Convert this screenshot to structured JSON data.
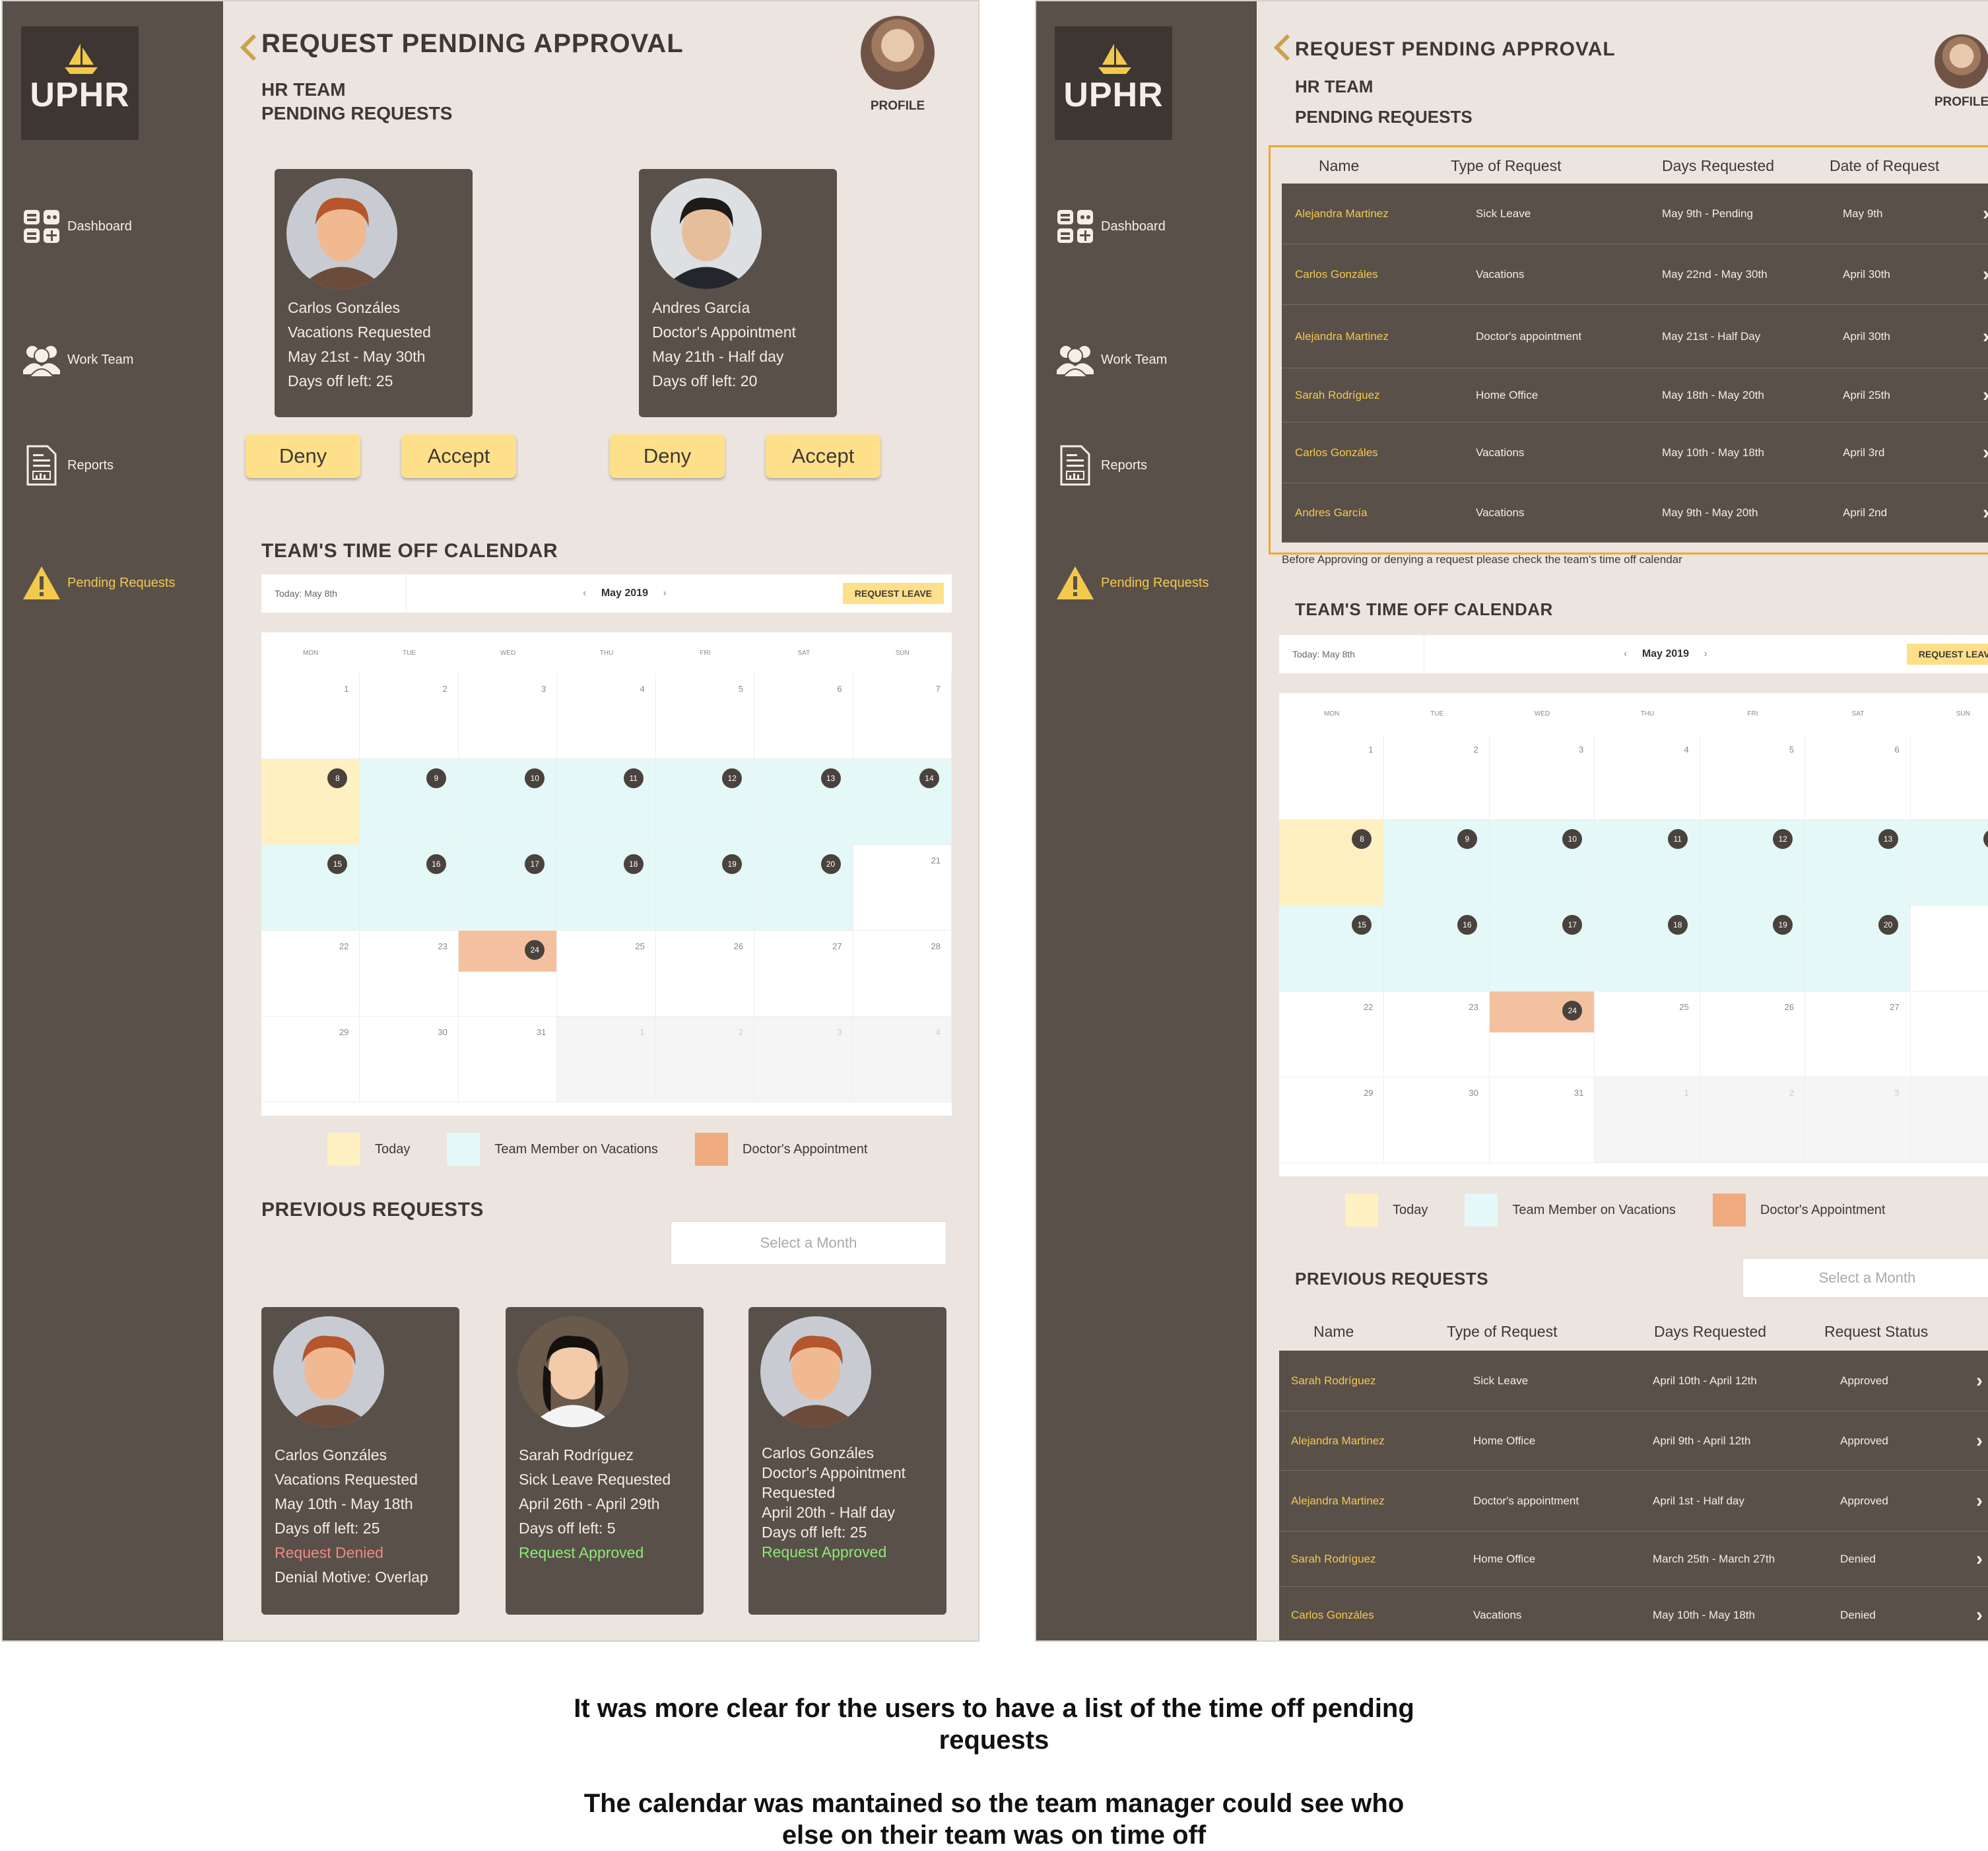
{
  "sidebar": {
    "logo": "UPHR",
    "items": [
      "Dashboard",
      "Work Team",
      "Reports",
      "Pending Requests"
    ]
  },
  "header": {
    "title": "REQUEST PENDING APPROVAL",
    "team": "HR TEAM",
    "subtitle": "PENDING REQUESTS",
    "profile": "PROFILE"
  },
  "pending_cards": [
    {
      "name": "Carlos Gonzáles",
      "type": "Vacations Requested",
      "dates": "May 21st - May 30th",
      "left": "Days off left: 25"
    },
    {
      "name": "Andres García",
      "type": "Doctor's Appointment",
      "dates": "May 21th - Half day",
      "left": "Days off left: 20"
    }
  ],
  "buttons": {
    "deny": "Deny",
    "accept": "Accept"
  },
  "calendar": {
    "section": "TEAM'S TIME OFF CALENDAR",
    "today": "Today: May 8th",
    "month": "May 2019",
    "request": "REQUEST LEAVE",
    "days": [
      "MON",
      "TUE",
      "WED",
      "THU",
      "FRI",
      "SAT",
      "SUN"
    ],
    "grid": [
      [
        "1",
        "2",
        "3",
        "4",
        "5",
        "6",
        "7"
      ],
      [
        "8",
        "9",
        "10",
        "11",
        "12",
        "13",
        "14"
      ],
      [
        "15",
        "16",
        "17",
        "18",
        "19",
        "20",
        "21"
      ],
      [
        "22",
        "23",
        "24",
        "25",
        "26",
        "27",
        "28"
      ],
      [
        "29",
        "30",
        "31",
        "1",
        "2",
        "3",
        "4"
      ]
    ],
    "legend": [
      "Today",
      "Team Member on Vacations",
      "Doctor's Appointment"
    ],
    "colors": {
      "today": "#fff0c2",
      "vacation": "#e3f8f7",
      "doctor": "#f4c1a0",
      "doctor_legend": "#efaa7e"
    }
  },
  "previous": {
    "section": "PREVIOUS REQUESTS",
    "select": "Select a Month",
    "cards": [
      {
        "lines": [
          "Carlos Gonzáles",
          "Vacations Requested",
          "May 10th - May 18th",
          "Days off left: 25"
        ],
        "status": "Request Denied",
        "extra": "Denial Motive: Overlap"
      },
      {
        "lines": [
          "Sarah Rodríguez",
          "Sick Leave Requested",
          "April 26th - April 29th",
          "Days off left: 5"
        ],
        "status": "Request Approved"
      },
      {
        "lines": [
          "Carlos Gonzáles",
          "Doctor's Appointment",
          "Requested",
          "April 20th - Half day",
          "Days off left: 25"
        ],
        "status": "Request Approved"
      }
    ]
  },
  "pending_table": {
    "headers": [
      "Name",
      "Type of Request",
      "Days Requested",
      "Date of Request"
    ],
    "rows": [
      [
        "Alejandra Martinez",
        "Sick Leave",
        "May 9th - Pending",
        "May 9th"
      ],
      [
        "Carlos Gonzáles",
        "Vacations",
        "May 22nd - May 30th",
        "April 30th"
      ],
      [
        "Alejandra Martinez",
        "Doctor's appointment",
        "May 21st - Half Day",
        "April 30th"
      ],
      [
        "Sarah Rodríguez",
        "Home Office",
        "May 18th - May 20th",
        "April 25th"
      ],
      [
        "Carlos Gonzáles",
        "Vacations",
        "May 10th - May 18th",
        "April 3rd"
      ],
      [
        "Andres García",
        "Vacations",
        "May 9th - May 20th",
        "April 2nd"
      ]
    ],
    "note": "Before Approving or denying a request please check the team's time off calendar"
  },
  "previous_table": {
    "headers": [
      "Name",
      "Type of Request",
      "Days Requested",
      "Request Status"
    ],
    "rows": [
      [
        "Sarah Rodríguez",
        "Sick Leave",
        "April 10th - April 12th",
        "Approved"
      ],
      [
        "Alejandra Martinez",
        "Home Office",
        "April 9th - April 12th",
        "Approved"
      ],
      [
        "Alejandra Martinez",
        "Doctor's appointment",
        "April 1st - Half day",
        "Approved"
      ],
      [
        "Sarah Rodríguez",
        "Home Office",
        "March 25th - March 27th",
        "Denied"
      ],
      [
        "Carlos Gonzáles",
        "Vacations",
        "May 10th - May 18th",
        "Denied"
      ]
    ]
  },
  "caption": {
    "line1": "It was more clear for the users to have a list of the time off pending",
    "line2": "requests",
    "line3": "The calendar was mantained so the team manager could see who",
    "line4": "else on their team was on time off"
  }
}
